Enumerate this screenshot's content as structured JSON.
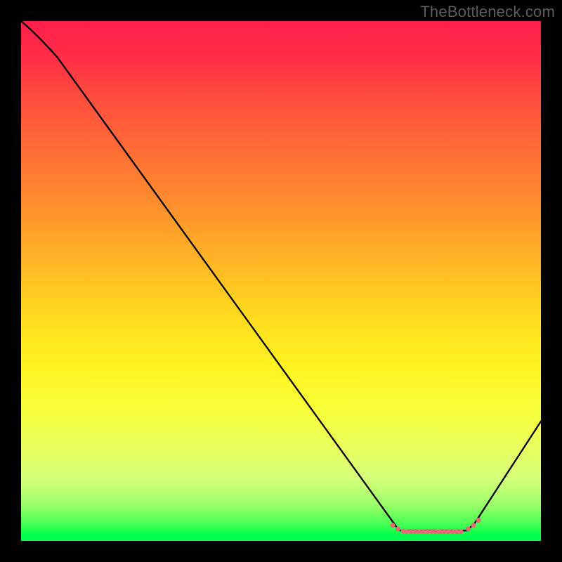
{
  "attribution": "TheBottleneck.com",
  "chart_data": {
    "type": "line",
    "title": "",
    "xlabel": "",
    "ylabel": "",
    "series": [
      {
        "name": "curve",
        "x": [
          0,
          0.07,
          0.72,
          0.73,
          0.86,
          0.87,
          1.0
        ],
        "y": [
          1.0,
          0.93,
          0.03,
          0.02,
          0.02,
          0.03,
          0.23
        ]
      }
    ],
    "markers": {
      "name": "bottom-dots",
      "x": [
        0.715,
        0.725,
        0.735,
        0.742,
        0.75,
        0.758,
        0.766,
        0.774,
        0.782,
        0.79,
        0.798,
        0.806,
        0.814,
        0.822,
        0.83,
        0.838,
        0.846,
        0.86,
        0.87,
        0.88
      ],
      "y": [
        0.03,
        0.023,
        0.019,
        0.018,
        0.018,
        0.018,
        0.018,
        0.018,
        0.018,
        0.018,
        0.018,
        0.018,
        0.018,
        0.018,
        0.018,
        0.018,
        0.018,
        0.023,
        0.03,
        0.04
      ],
      "color": "#e46a74",
      "size": 7
    },
    "ylim": [
      0,
      1
    ],
    "xlim": [
      0,
      1
    ],
    "background_gradient": [
      "#ff1f4b",
      "#ffd51f",
      "#fff320",
      "#00ff4e"
    ]
  }
}
